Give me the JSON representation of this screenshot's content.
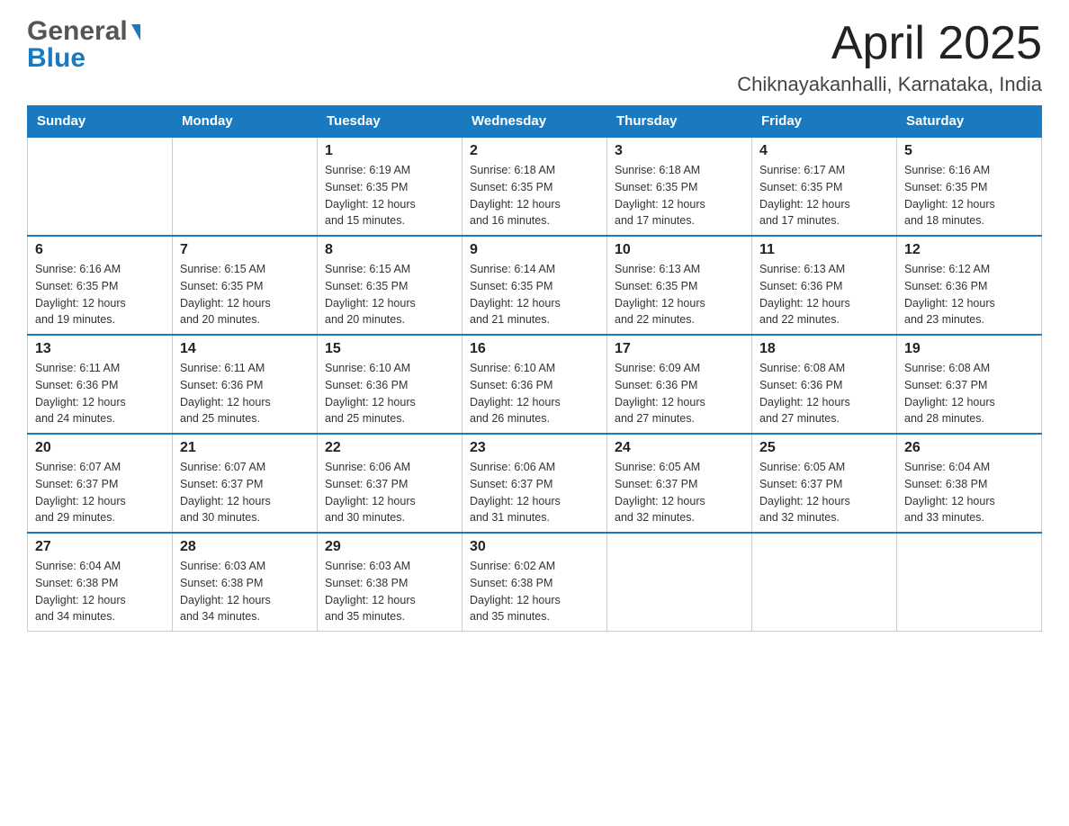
{
  "header": {
    "title": "April 2025",
    "location": "Chiknayakanhalli, Karnataka, India",
    "logo_general": "General",
    "logo_blue": "Blue"
  },
  "weekdays": [
    "Sunday",
    "Monday",
    "Tuesday",
    "Wednesday",
    "Thursday",
    "Friday",
    "Saturday"
  ],
  "weeks": [
    [
      {
        "day": "",
        "info": ""
      },
      {
        "day": "",
        "info": ""
      },
      {
        "day": "1",
        "info": "Sunrise: 6:19 AM\nSunset: 6:35 PM\nDaylight: 12 hours\nand 15 minutes."
      },
      {
        "day": "2",
        "info": "Sunrise: 6:18 AM\nSunset: 6:35 PM\nDaylight: 12 hours\nand 16 minutes."
      },
      {
        "day": "3",
        "info": "Sunrise: 6:18 AM\nSunset: 6:35 PM\nDaylight: 12 hours\nand 17 minutes."
      },
      {
        "day": "4",
        "info": "Sunrise: 6:17 AM\nSunset: 6:35 PM\nDaylight: 12 hours\nand 17 minutes."
      },
      {
        "day": "5",
        "info": "Sunrise: 6:16 AM\nSunset: 6:35 PM\nDaylight: 12 hours\nand 18 minutes."
      }
    ],
    [
      {
        "day": "6",
        "info": "Sunrise: 6:16 AM\nSunset: 6:35 PM\nDaylight: 12 hours\nand 19 minutes."
      },
      {
        "day": "7",
        "info": "Sunrise: 6:15 AM\nSunset: 6:35 PM\nDaylight: 12 hours\nand 20 minutes."
      },
      {
        "day": "8",
        "info": "Sunrise: 6:15 AM\nSunset: 6:35 PM\nDaylight: 12 hours\nand 20 minutes."
      },
      {
        "day": "9",
        "info": "Sunrise: 6:14 AM\nSunset: 6:35 PM\nDaylight: 12 hours\nand 21 minutes."
      },
      {
        "day": "10",
        "info": "Sunrise: 6:13 AM\nSunset: 6:35 PM\nDaylight: 12 hours\nand 22 minutes."
      },
      {
        "day": "11",
        "info": "Sunrise: 6:13 AM\nSunset: 6:36 PM\nDaylight: 12 hours\nand 22 minutes."
      },
      {
        "day": "12",
        "info": "Sunrise: 6:12 AM\nSunset: 6:36 PM\nDaylight: 12 hours\nand 23 minutes."
      }
    ],
    [
      {
        "day": "13",
        "info": "Sunrise: 6:11 AM\nSunset: 6:36 PM\nDaylight: 12 hours\nand 24 minutes."
      },
      {
        "day": "14",
        "info": "Sunrise: 6:11 AM\nSunset: 6:36 PM\nDaylight: 12 hours\nand 25 minutes."
      },
      {
        "day": "15",
        "info": "Sunrise: 6:10 AM\nSunset: 6:36 PM\nDaylight: 12 hours\nand 25 minutes."
      },
      {
        "day": "16",
        "info": "Sunrise: 6:10 AM\nSunset: 6:36 PM\nDaylight: 12 hours\nand 26 minutes."
      },
      {
        "day": "17",
        "info": "Sunrise: 6:09 AM\nSunset: 6:36 PM\nDaylight: 12 hours\nand 27 minutes."
      },
      {
        "day": "18",
        "info": "Sunrise: 6:08 AM\nSunset: 6:36 PM\nDaylight: 12 hours\nand 27 minutes."
      },
      {
        "day": "19",
        "info": "Sunrise: 6:08 AM\nSunset: 6:37 PM\nDaylight: 12 hours\nand 28 minutes."
      }
    ],
    [
      {
        "day": "20",
        "info": "Sunrise: 6:07 AM\nSunset: 6:37 PM\nDaylight: 12 hours\nand 29 minutes."
      },
      {
        "day": "21",
        "info": "Sunrise: 6:07 AM\nSunset: 6:37 PM\nDaylight: 12 hours\nand 30 minutes."
      },
      {
        "day": "22",
        "info": "Sunrise: 6:06 AM\nSunset: 6:37 PM\nDaylight: 12 hours\nand 30 minutes."
      },
      {
        "day": "23",
        "info": "Sunrise: 6:06 AM\nSunset: 6:37 PM\nDaylight: 12 hours\nand 31 minutes."
      },
      {
        "day": "24",
        "info": "Sunrise: 6:05 AM\nSunset: 6:37 PM\nDaylight: 12 hours\nand 32 minutes."
      },
      {
        "day": "25",
        "info": "Sunrise: 6:05 AM\nSunset: 6:37 PM\nDaylight: 12 hours\nand 32 minutes."
      },
      {
        "day": "26",
        "info": "Sunrise: 6:04 AM\nSunset: 6:38 PM\nDaylight: 12 hours\nand 33 minutes."
      }
    ],
    [
      {
        "day": "27",
        "info": "Sunrise: 6:04 AM\nSunset: 6:38 PM\nDaylight: 12 hours\nand 34 minutes."
      },
      {
        "day": "28",
        "info": "Sunrise: 6:03 AM\nSunset: 6:38 PM\nDaylight: 12 hours\nand 34 minutes."
      },
      {
        "day": "29",
        "info": "Sunrise: 6:03 AM\nSunset: 6:38 PM\nDaylight: 12 hours\nand 35 minutes."
      },
      {
        "day": "30",
        "info": "Sunrise: 6:02 AM\nSunset: 6:38 PM\nDaylight: 12 hours\nand 35 minutes."
      },
      {
        "day": "",
        "info": ""
      },
      {
        "day": "",
        "info": ""
      },
      {
        "day": "",
        "info": ""
      }
    ]
  ]
}
